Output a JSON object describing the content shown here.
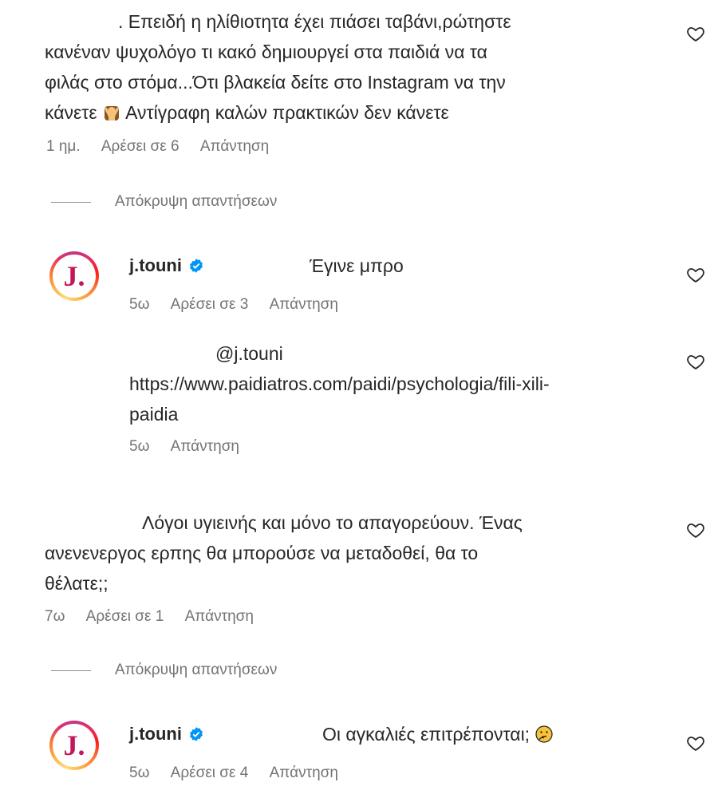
{
  "comments": [
    {
      "text_lines": [
        ". Επειδή η ηλίθιοτητα έχει πιάσει ταβάνι,ρώτηστε",
        "κανέναν ψυχολόγο τι κακό δημιουργεί στα παιδιά να τα",
        "φιλάς στο στόμα...Ότι βλακεία δείτε στο Instagram να την",
        "κάνετε",
        "Αντίγραφη καλών πρακτικών δεν κάνετε"
      ],
      "emoji": "person-gesturing-no-emoji",
      "time": "1 ημ.",
      "likes": "Αρέσει σε 6",
      "reply": "Απάντηση"
    },
    {
      "text_lines": [
        "Λόγοι υγιεινής και μόνο το απαγορεύουν. Ένας",
        "ανενενεργος ερπης θα μπορούσε να μεταδοθεί, θα το",
        "θέλατε;;"
      ],
      "time": "7ω",
      "likes": "Αρέσει σε 1",
      "reply": "Απάντηση"
    }
  ],
  "hide_replies_label": "Απόκρυψη απαντήσεων",
  "replies": [
    {
      "avatar_letter": "J.",
      "username": "j.touni",
      "text": "Έγινε μπρο",
      "time": "5ω",
      "likes": "Αρέσει σε 3",
      "reply": "Απάντηση"
    },
    {
      "mention": "@j.touni",
      "link_line1": "https://www.paidiatros.com/paidi/psychologia/fili-xili-",
      "link_line2": "paidia",
      "time": "5ω",
      "reply": "Απάντηση"
    },
    {
      "avatar_letter": "J.",
      "username": "j.touni",
      "text": "Οι αγκαλιές επιτρέπονται;",
      "emoji": "thinking-face-emoji",
      "time": "5ω",
      "likes": "Αρέσει σε 4",
      "reply": "Απάντηση"
    }
  ],
  "icons": {
    "heart": "heart-outline-icon",
    "verified": "verified-badge-icon"
  },
  "colors": {
    "text": "#262626",
    "meta": "#737373",
    "verified": "#0095f6",
    "avatar_letter": "#c2185b"
  }
}
